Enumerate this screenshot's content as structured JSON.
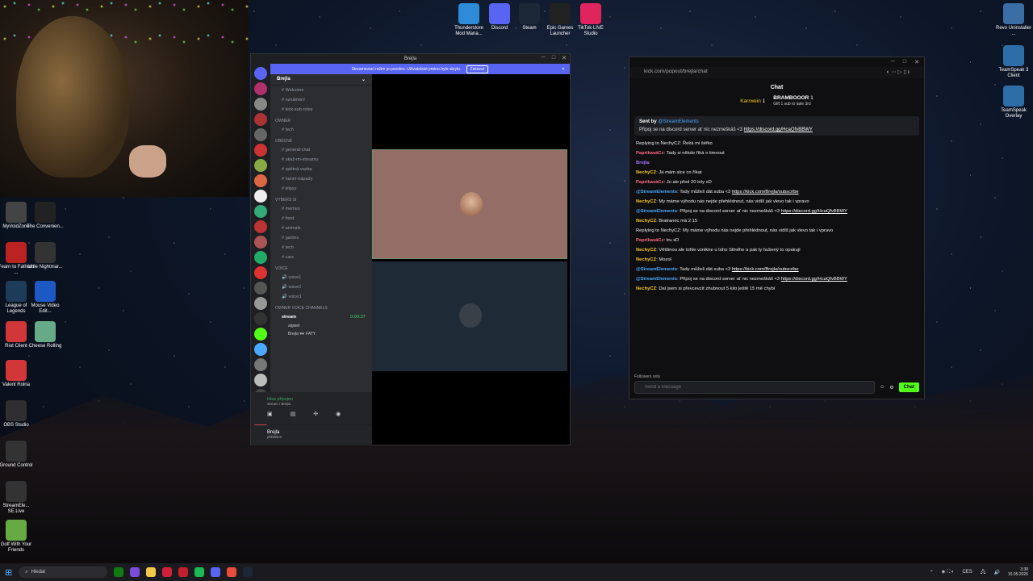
{
  "discord": {
    "window_title": "Brejla",
    "banner_text": "Streamovací režim je povolen. Uživatelské jméno bylo skryto.",
    "banner_button": "Zakázat",
    "guild_name": "Brejla",
    "channels_top": [
      "Welcome",
      "oznámení",
      "kick-sub-roles"
    ],
    "cat_owner": "OWNER",
    "owner_channels": [
      "tech"
    ],
    "cat_general": "OBECNÉ",
    "general_channels": [
      "general-chat",
      "ukaž-mi-streamu",
      "zpětná-vazba",
      "hanní-nápady",
      "klipyy"
    ],
    "cat_other": "VYBERS SI",
    "other_channels": [
      "memes",
      "food",
      "animals",
      "games",
      "tech",
      "cars"
    ],
    "cat_voice": "VOICE",
    "voice_channels": [
      "voice1",
      "voice2",
      "voice3"
    ],
    "cat_owner_voice": "OWNER VOICE CHANNELS",
    "stream_channel": "stream",
    "stream_time": "0:00:27",
    "voice_users": [
      "algwet",
      "Brejla 🕶 FATY"
    ],
    "voice_status": "Hlas připojen",
    "voice_sub": "stream / Brejla",
    "user_name": "Brejla",
    "user_status": "přihlášen"
  },
  "kick": {
    "url": "kick.com/popout/brejla/chat",
    "title": "Chat",
    "gift_user": "Karrwein",
    "gift_count": "1",
    "gift_target": "BRAMBOOOR",
    "gift_target_count": "1",
    "gift_text": "Gift 1 sub to take 3rd",
    "pinned_sent_by": "Sent by",
    "pinned_user": "@StreamElements",
    "pinned_text": "Připoj se na discord server ať nic nezmeškáš <3",
    "pinned_link": "https://discord.gg/HcaQfvBBWY",
    "messages": [
      {
        "reply": "Replying to NechyCZ: Řeká mi šéfko",
        "user": "PaprikaváCz",
        "color": "#ff6b81",
        "text": "Tady si někdo říká o timeout"
      },
      {
        "user": "Brejla",
        "color": "#b070ff",
        "text": ""
      },
      {
        "user": "NechyCZ",
        "color": "#f7c520",
        "text": "Já mám sice co říkat"
      },
      {
        "user": "PaprikaváCz",
        "color": "#ff6b81",
        "text": "Jo ale před 20 lety xD"
      },
      {
        "user": "@StreamElements",
        "color": "#4aa8ff",
        "text": "Tady můžeš dát suba <3",
        "link": "https://kick.com/Brejla/subscribe"
      },
      {
        "user": "NechyCZ",
        "color": "#f7c520",
        "text": "My máme výhodu nás nejde přehlédnout, nás vidíš jak vlevo tak i vpravo"
      },
      {
        "user": "@StreamElements",
        "color": "#4aa8ff",
        "text": "Připoj se na discord server ať nic nezmeškáš <3",
        "link": "https://discord.gg/HcaQfvBBWY"
      },
      {
        "user": "NechyCZ",
        "color": "#f7c520",
        "text": "Bratranec má 2:15"
      },
      {
        "reply": "Replying to NechyCZ: My máme výhodu nás nejde přehlédnout, nás vidíš jak vlevo tak i vpravo",
        "user": "PaprikaváCz",
        "color": "#ff6b81",
        "text": "tru xD"
      },
      {
        "user": "NechyCZ",
        "color": "#f7c520",
        "text": "Většinou ale tohle vznikne u toho Silného a pak ty hubený to opakují"
      },
      {
        "user": "NechyCZ",
        "color": "#f7c520",
        "text": "Mozol"
      },
      {
        "user": "@StreamElements",
        "color": "#4aa8ff",
        "text": "Tady můžeš dát suba <3",
        "link": "https://kick.com/Brejla/subscribe"
      },
      {
        "user": "@StreamElements",
        "color": "#4aa8ff",
        "text": "Připoj se na discord server ať nic nezmeškáš <3",
        "link": "https://discord.gg/HcaQfvBBWY"
      },
      {
        "user": "NechyCZ",
        "color": "#f7c520",
        "text": "Dal jsem si převcevzít zhubnout 5 kilo ještě 15 mě chybí"
      }
    ],
    "followers_only": "Followers only",
    "input_placeholder": "Send a message",
    "send_label": "Chat"
  },
  "desktop_icons": {
    "top": [
      {
        "label": "Thunderstore Mod Mana...",
        "color": "#2d8bd8"
      },
      {
        "label": "Discord",
        "color": "#5865f2"
      },
      {
        "label": "Steam",
        "color": "#1b2838"
      },
      {
        "label": "Epic Games Launcher",
        "color": "#222"
      },
      {
        "label": "TikTok LIVE Studio",
        "color": "#e0245e"
      }
    ],
    "right": [
      {
        "label": "Revo Uninstaller ...",
        "color": "#3a6ea5"
      },
      {
        "label": "TeamSpeak 3 Client",
        "color": "#2e6ea8"
      },
      {
        "label": "TeamSpeak Overlay",
        "color": "#2e6ea8"
      }
    ],
    "left": [
      {
        "label": "MyVoidZone",
        "color": "#444"
      },
      {
        "label": "The Convenien...",
        "color": "#222"
      },
      {
        "label": "Fearn to Fathom ...",
        "color": "#b22"
      },
      {
        "label": "Little Nightmar...",
        "color": "#333"
      },
      {
        "label": "League of Legends",
        "color": "#1c3c5a"
      },
      {
        "label": "Mouse Video Edit...",
        "color": "#1d59c4"
      },
      {
        "label": "Riot Client",
        "color": "#d13639"
      },
      {
        "label": "Cheese Rolling",
        "color": "#6a8"
      },
      {
        "label": "Valent Rolna",
        "color": "#d13639"
      },
      {
        "label": "OBS Studio",
        "color": "#302e31"
      },
      {
        "label": "Ground Control",
        "color": "#333"
      },
      {
        "label": "StreamEle... SE.Live",
        "color": "#333"
      },
      {
        "label": "Golf With Your Friends",
        "color": "#6a4"
      }
    ]
  },
  "taskbar": {
    "search_placeholder": "Hledat",
    "lang": "CES",
    "time": "3:38",
    "date": "16.05.2026"
  }
}
